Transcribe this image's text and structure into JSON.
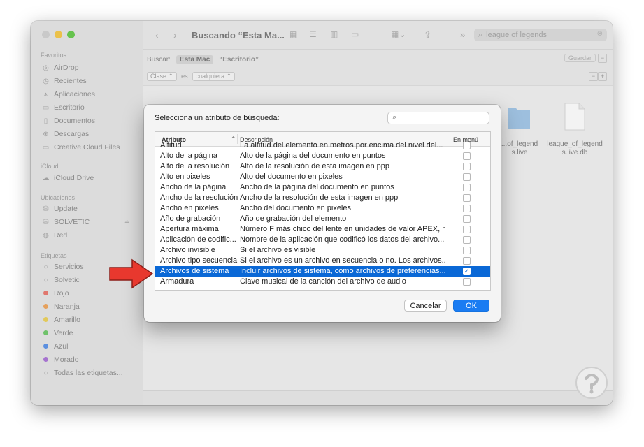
{
  "window": {
    "title": "Buscando “Esta Ma...",
    "search_query": "league of legends"
  },
  "sidebar": {
    "favoritos_title": "Favoritos",
    "favoritos": [
      {
        "label": "AirDrop",
        "icon": "airdrop-icon"
      },
      {
        "label": "Recientes",
        "icon": "clock-icon"
      },
      {
        "label": "Aplicaciones",
        "icon": "apps-icon"
      },
      {
        "label": "Escritorio",
        "icon": "desktop-icon"
      },
      {
        "label": "Documentos",
        "icon": "document-icon"
      },
      {
        "label": "Descargas",
        "icon": "download-icon"
      },
      {
        "label": "Creative Cloud Files",
        "icon": "folder-icon"
      }
    ],
    "icloud_title": "iCloud",
    "icloud": [
      {
        "label": "iCloud Drive",
        "icon": "cloud-icon"
      }
    ],
    "ubicaciones_title": "Ubicaciones",
    "ubicaciones": [
      {
        "label": "Update",
        "icon": "drive-icon"
      },
      {
        "label": "SOLVETIC",
        "icon": "drive-icon"
      },
      {
        "label": "Red",
        "icon": "network-icon"
      }
    ],
    "etiquetas_title": "Etiquetas",
    "etiquetas": [
      {
        "label": "Servicios",
        "color": ""
      },
      {
        "label": "Solvetic",
        "color": ""
      },
      {
        "label": "Rojo",
        "color": "#e0776e"
      },
      {
        "label": "Naranja",
        "color": "#e5a05c"
      },
      {
        "label": "Amarillo",
        "color": "#e2c95a"
      },
      {
        "label": "Verde",
        "color": "#6fc26a"
      },
      {
        "label": "Azul",
        "color": "#5b8fdf"
      },
      {
        "label": "Morado",
        "color": "#a673cf"
      },
      {
        "label": "Todas las etiquetas...",
        "color": ""
      }
    ]
  },
  "scope_bar": {
    "buscar_label": "Buscar:",
    "scope_active": "Esta Mac",
    "scope_other": "“Escritorio”",
    "save_label": "Guardar",
    "minus": "−",
    "plus": "+"
  },
  "criteria": {
    "attribute": "Clase",
    "operator": "es",
    "value": "cualquiera"
  },
  "results": {
    "files": [
      {
        "name_line1": "...of_legend",
        "name_line2": "s.live"
      },
      {
        "name_line1": "league_of_legend",
        "name_line2": "s.live.db"
      }
    ]
  },
  "dialog": {
    "prompt": "Selecciona un atributo de búsqueda:",
    "columns": {
      "attribute": "Atributo",
      "description": "Descripción",
      "menu": "En menú"
    },
    "rows": [
      {
        "attr": "Altitud",
        "desc": "La altitud del elemento en metros por encima del nivel del...",
        "checked": false
      },
      {
        "attr": "Alto de la página",
        "desc": "Alto de la página del documento en puntos",
        "checked": false
      },
      {
        "attr": "Alto de la resolución",
        "desc": "Alto de la resolución de esta imagen en ppp",
        "checked": false
      },
      {
        "attr": "Alto en pixeles",
        "desc": "Alto del documento en pixeles",
        "checked": false
      },
      {
        "attr": "Ancho de la página",
        "desc": "Ancho de la página del documento en puntos",
        "checked": false
      },
      {
        "attr": "Ancho de la resolución",
        "desc": "Ancho de la resolución de esta imagen en ppp",
        "checked": false
      },
      {
        "attr": "Ancho en pixeles",
        "desc": "Ancho del documento en pixeles",
        "checked": false
      },
      {
        "attr": "Año de grabación",
        "desc": "Año de grabación del elemento",
        "checked": false
      },
      {
        "attr": "Apertura máxima",
        "desc": "Número F más chico del lente en unidades de valor APEX, n...",
        "checked": false
      },
      {
        "attr": "Aplicación de codific...",
        "desc": "Nombre de la aplicación que codificó los datos del archivo...",
        "checked": false
      },
      {
        "attr": "Archivo invisible",
        "desc": "Si el archivo es visible",
        "checked": false
      },
      {
        "attr": "Archivo tipo secuencia",
        "desc": "Si el archivo es un archivo en secuencia o no. Los archivos...",
        "checked": false
      },
      {
        "attr": "Archivos de sistema",
        "desc": "Incluir archivos de sistema, como archivos de preferencias...",
        "checked": true,
        "selected": true
      },
      {
        "attr": "Armadura",
        "desc": "Clave musical de la canción del archivo de audio",
        "checked": false
      }
    ],
    "cancel_label": "Cancelar",
    "ok_label": "OK"
  },
  "colors": {
    "selection": "#0a68d6",
    "ok_button": "#1a7cf2",
    "arrow": "#e8382e"
  }
}
